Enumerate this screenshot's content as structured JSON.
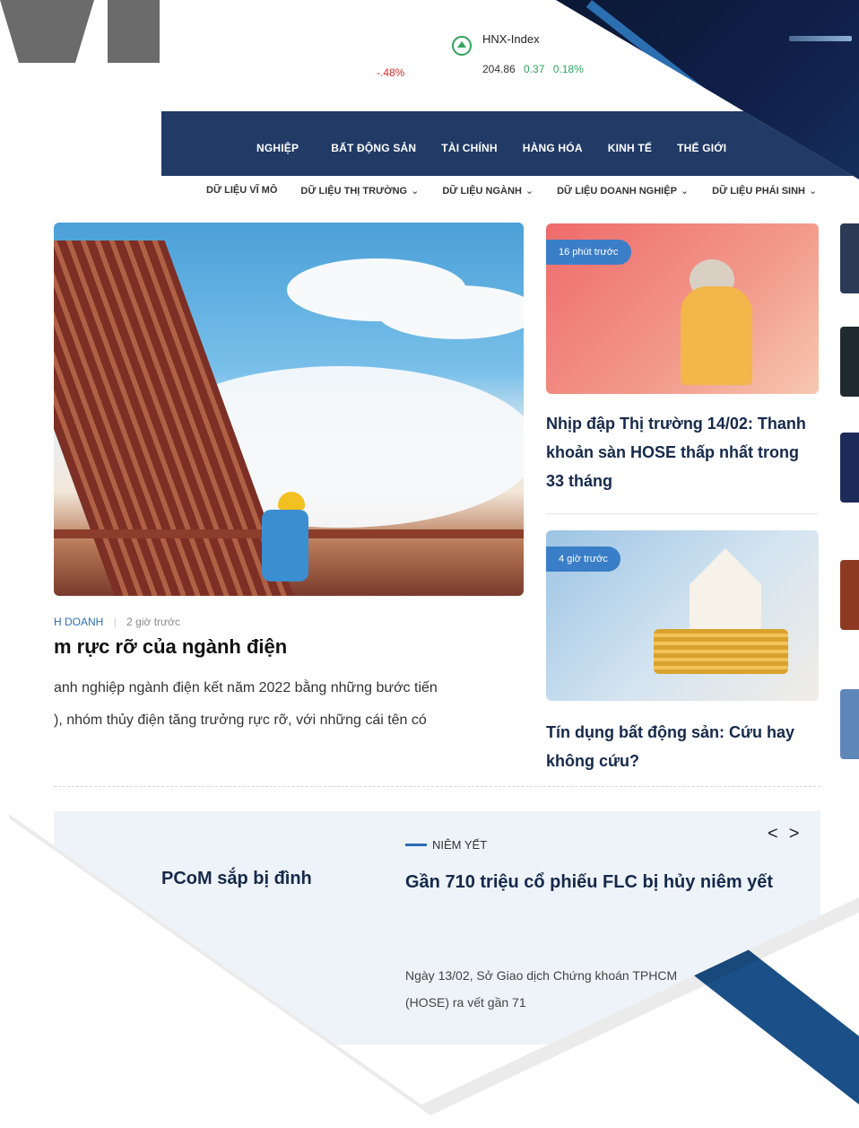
{
  "ticker": {
    "left_pct": "-.48%",
    "hnx": {
      "name": "HNX-Index",
      "value": "204.86",
      "change": "0.37",
      "pct": "0.18%"
    }
  },
  "nav": {
    "items": [
      "NGHIỆP",
      "BẤT ĐỘNG SẢN",
      "TÀI CHÍNH",
      "HÀNG HÓA",
      "KINH TẾ",
      "THẾ GIỚI"
    ]
  },
  "subnav": {
    "items": [
      "DỮ LIỆU VĨ MÔ",
      "DỮ LIỆU THỊ TRƯỜNG",
      "DỮ LIỆU NGÀNH",
      "DỮ LIỆU DOANH NGHIỆP",
      "DỮ LIỆU PHÁI SINH"
    ]
  },
  "hero": {
    "category": "H DOANH",
    "time": "2 giờ trước",
    "title": "m rực rỡ của ngành điện",
    "lead_line1": "anh nghiệp ngành điện kết năm 2022 bằng những bước tiến",
    "lead_line2": "), nhóm thủy điện tăng trưởng rực rỡ, với những cái tên có"
  },
  "cards": [
    {
      "badge": "16 phút trước",
      "title": "Nhịp đập Thị trường 14/02: Thanh khoản sàn HOSE thấp nhất trong 33 tháng"
    },
    {
      "badge": "4 giờ trước",
      "title": "Tín dụng bất động sản: Cứu hay không cứu?"
    }
  ],
  "listed": {
    "left_title": "PCoM sắp bị đình",
    "category": "NIÊM YẾT",
    "title": "Gần 710 triệu cổ phiếu FLC bị hủy niêm yết",
    "body": "Ngày 13/02, Sở Giao dịch Chứng khoán TPHCM (HOSE) ra vết gần 71",
    "prev": "<",
    "next": ">"
  }
}
